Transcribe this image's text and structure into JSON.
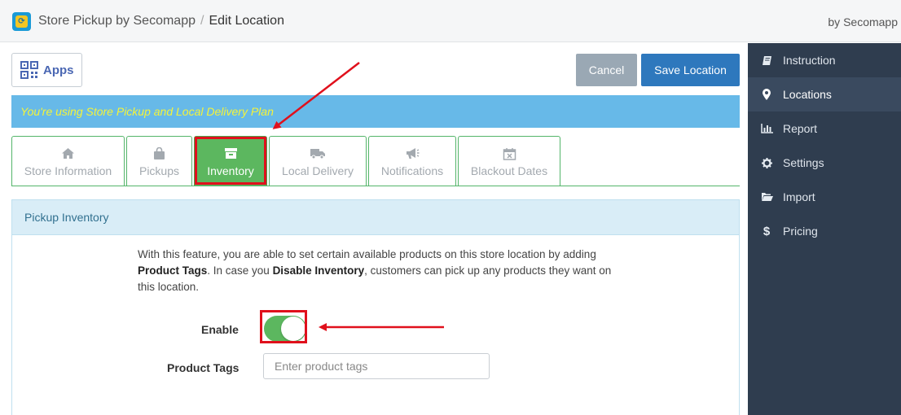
{
  "header": {
    "app_name": "Store Pickup by Secomapp",
    "separator": "/",
    "page": "Edit Location",
    "by": "by Secomapp"
  },
  "toolbar": {
    "apps_label": "Apps",
    "cancel_label": "Cancel",
    "save_label": "Save Location"
  },
  "banner": {
    "text": "You're using Store Pickup and Local Delivery Plan",
    "text_color": "#f4f33a",
    "bg_color": "#67b9e8"
  },
  "tabs": [
    {
      "label": "Store Information",
      "icon": "home-icon"
    },
    {
      "label": "Pickups",
      "icon": "shopping-bag-icon"
    },
    {
      "label": "Inventory",
      "icon": "archive-box-icon",
      "active": true
    },
    {
      "label": "Local Delivery",
      "icon": "truck-icon"
    },
    {
      "label": "Notifications",
      "icon": "megaphone-icon"
    },
    {
      "label": "Blackout Dates",
      "icon": "calendar-x-icon"
    }
  ],
  "panel": {
    "title": "Pickup Inventory",
    "desc_1": "With this feature, you are able to set certain available products on this store location by adding ",
    "desc_bold_1": "Product Tags",
    "desc_2": ". In case you ",
    "desc_bold_2": "Disable Inventory",
    "desc_3": ", customers can pick up any products they want on this location.",
    "enable_label": "Enable",
    "enable_value": true,
    "tags_label": "Product Tags",
    "tags_placeholder": "Enter product tags",
    "tags_value": ""
  },
  "sidebar": {
    "items": [
      {
        "label": "Instruction",
        "icon": "book-icon"
      },
      {
        "label": "Locations",
        "icon": "map-marker-icon",
        "active": true
      },
      {
        "label": "Report",
        "icon": "bar-chart-icon"
      },
      {
        "label": "Settings",
        "icon": "gear-icon"
      },
      {
        "label": "Import",
        "icon": "folder-open-icon"
      },
      {
        "label": "Pricing",
        "icon": "dollar-icon"
      }
    ]
  },
  "colors": {
    "accent_green": "#5cb75f",
    "primary_blue": "#2e78bd",
    "sidebar_bg": "#2f3d4f",
    "annotation_red": "#e0101c"
  }
}
